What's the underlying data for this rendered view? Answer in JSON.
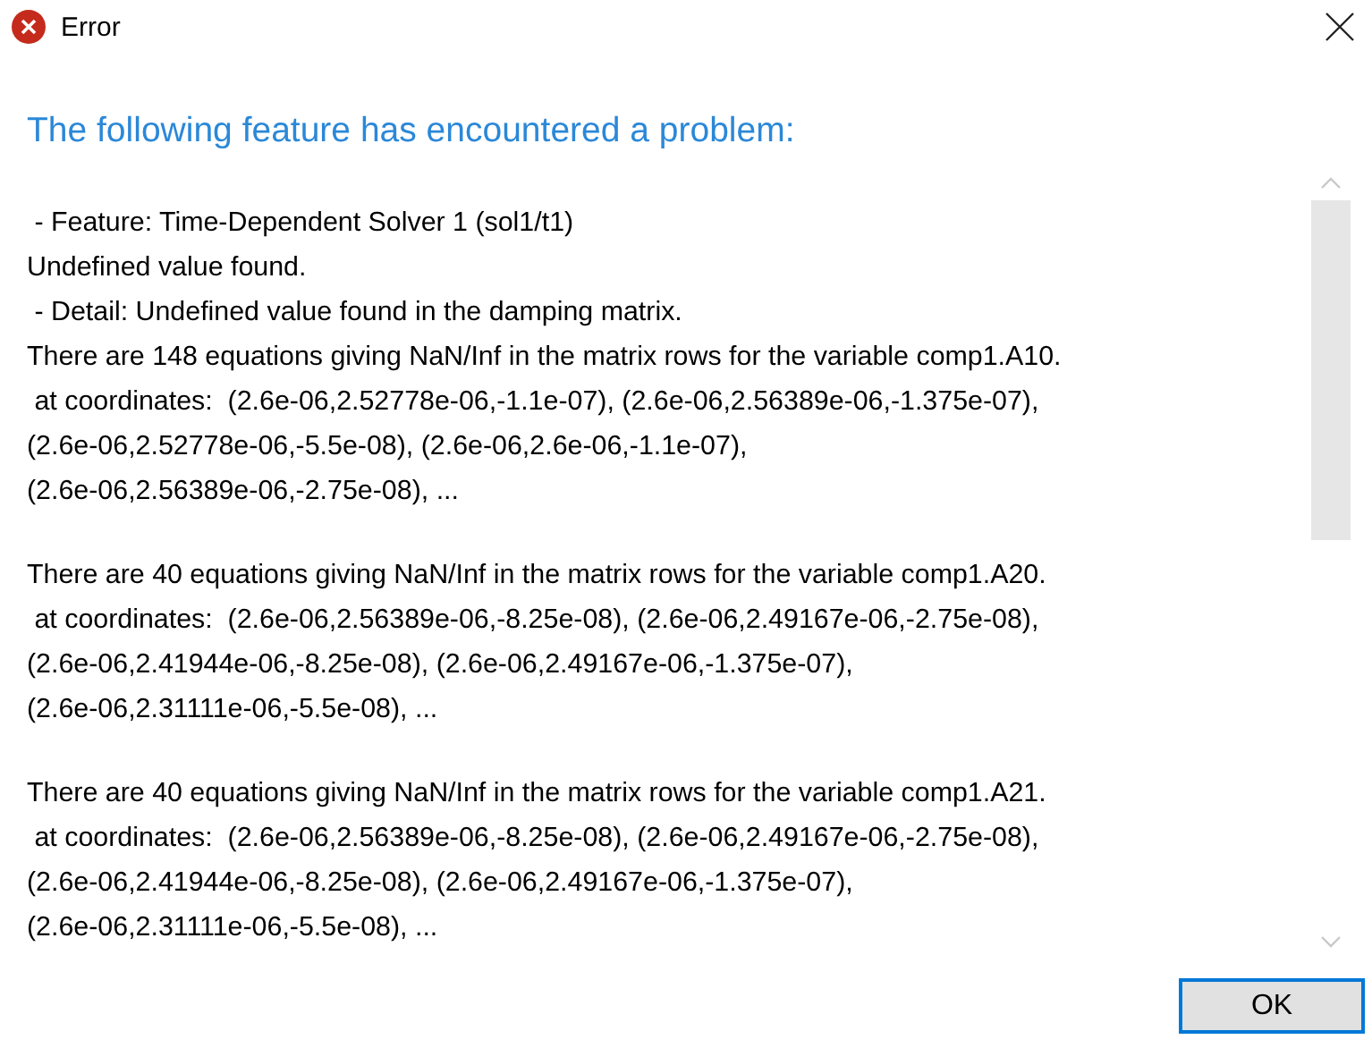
{
  "window": {
    "title": "Error"
  },
  "heading": "The following feature has encountered a problem:",
  "message_blocks": [
    {
      "lines": [
        " - Feature: Time-Dependent Solver 1 (sol1/t1)",
        "Undefined value found.",
        " - Detail: Undefined value found in the damping matrix.",
        "There are 148 equations giving NaN/Inf in the matrix rows for the variable comp1.A10.",
        " at coordinates:  (2.6e-06,2.52778e-06,-1.1e-07), (2.6e-06,2.56389e-06,-1.375e-07),",
        "(2.6e-06,2.52778e-06,-5.5e-08), (2.6e-06,2.6e-06,-1.1e-07),",
        "(2.6e-06,2.56389e-06,-2.75e-08), ..."
      ]
    },
    {
      "lines": [
        "There are 40 equations giving NaN/Inf in the matrix rows for the variable comp1.A20.",
        " at coordinates:  (2.6e-06,2.56389e-06,-8.25e-08), (2.6e-06,2.49167e-06,-2.75e-08),",
        "(2.6e-06,2.41944e-06,-8.25e-08), (2.6e-06,2.49167e-06,-1.375e-07),",
        "(2.6e-06,2.31111e-06,-5.5e-08), ..."
      ]
    },
    {
      "lines": [
        "There are 40 equations giving NaN/Inf in the matrix rows for the variable comp1.A21.",
        " at coordinates:  (2.6e-06,2.56389e-06,-8.25e-08), (2.6e-06,2.49167e-06,-2.75e-08),",
        "(2.6e-06,2.41944e-06,-8.25e-08), (2.6e-06,2.49167e-06,-1.375e-07),",
        "(2.6e-06,2.31111e-06,-5.5e-08), ..."
      ]
    }
  ],
  "buttons": [
    {
      "label": "OK",
      "selected": true
    }
  ]
}
